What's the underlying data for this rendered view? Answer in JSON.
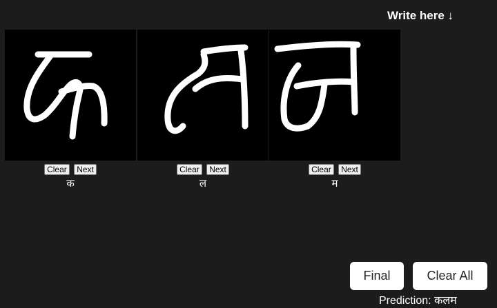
{
  "header": {
    "hint": "Write here ↓"
  },
  "cells": [
    {
      "clear_label": "Clear",
      "next_label": "Next",
      "prediction": "क"
    },
    {
      "clear_label": "Clear",
      "next_label": "Next",
      "prediction": "ल"
    },
    {
      "clear_label": "Clear",
      "next_label": "Next",
      "prediction": "म"
    }
  ],
  "actions": {
    "final_label": "Final",
    "clear_all_label": "Clear All"
  },
  "result": {
    "prediction_text": "Prediction: कलम"
  },
  "colors": {
    "background": "#1c1c1c",
    "canvas": "#000000",
    "ink": "#ffffff"
  }
}
